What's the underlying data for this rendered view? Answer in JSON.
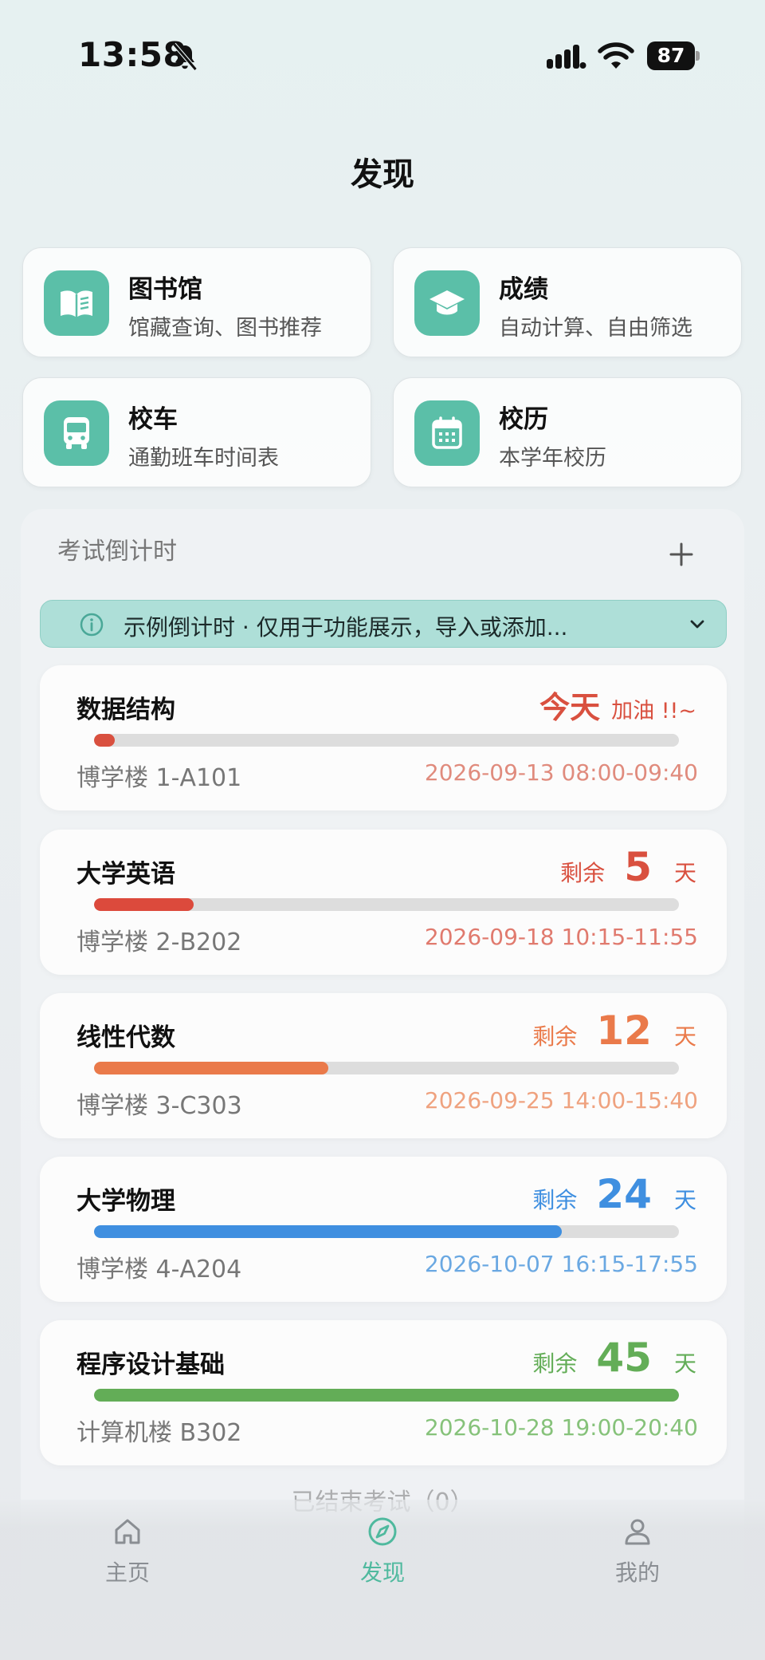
{
  "status_bar": {
    "time": "13:58",
    "battery": "87"
  },
  "header": {
    "title": "发现"
  },
  "features": [
    {
      "title": "图书馆",
      "subtitle": "馆藏查询、图书推荐",
      "icon": "book-icon"
    },
    {
      "title": "成绩",
      "subtitle": "自动计算、自由筛选",
      "icon": "graduation-cap-icon"
    },
    {
      "title": "校车",
      "subtitle": "通勤班车时间表",
      "icon": "bus-icon"
    },
    {
      "title": "校历",
      "subtitle": "本学年校历",
      "icon": "calendar-icon"
    }
  ],
  "countdown": {
    "title": "考试倒计时",
    "notice": "示例倒计时 · 仅用于功能展示，导入或添加...",
    "exams": [
      {
        "name": "数据结构",
        "today_label": "今天",
        "cheer": "加油 !!~",
        "location": "博学楼 1-A101",
        "time": "2026-09-13 08:00-09:40",
        "progress": 0.03,
        "color": "#d9503f"
      },
      {
        "name": "大学英语",
        "prefix": "剩余",
        "days": "5",
        "suffix": "天",
        "location": "博学楼 2-B202",
        "time": "2026-09-18 10:15-11:55",
        "progress": 0.17,
        "color": "#dc4a3c"
      },
      {
        "name": "线性代数",
        "prefix": "剩余",
        "days": "12",
        "suffix": "天",
        "location": "博学楼 3-C303",
        "time": "2026-09-25 14:00-15:40",
        "progress": 0.4,
        "color": "#ea7a4a"
      },
      {
        "name": "大学物理",
        "prefix": "剩余",
        "days": "24",
        "suffix": "天",
        "location": "博学楼 4-A204",
        "time": "2026-10-07 16:15-17:55",
        "progress": 0.8,
        "color": "#3f8fe0"
      },
      {
        "name": "程序设计基础",
        "prefix": "剩余",
        "days": "45",
        "suffix": "天",
        "location": "计算机楼 B302",
        "time": "2026-10-28 19:00-20:40",
        "progress": 1.0,
        "color": "#63ad57"
      }
    ],
    "finished_label": "已结束考试（0）"
  },
  "tabs": [
    {
      "label": "主页",
      "icon": "home-icon"
    },
    {
      "label": "发现",
      "icon": "compass-icon",
      "active": true
    },
    {
      "label": "我的",
      "icon": "user-icon"
    }
  ]
}
